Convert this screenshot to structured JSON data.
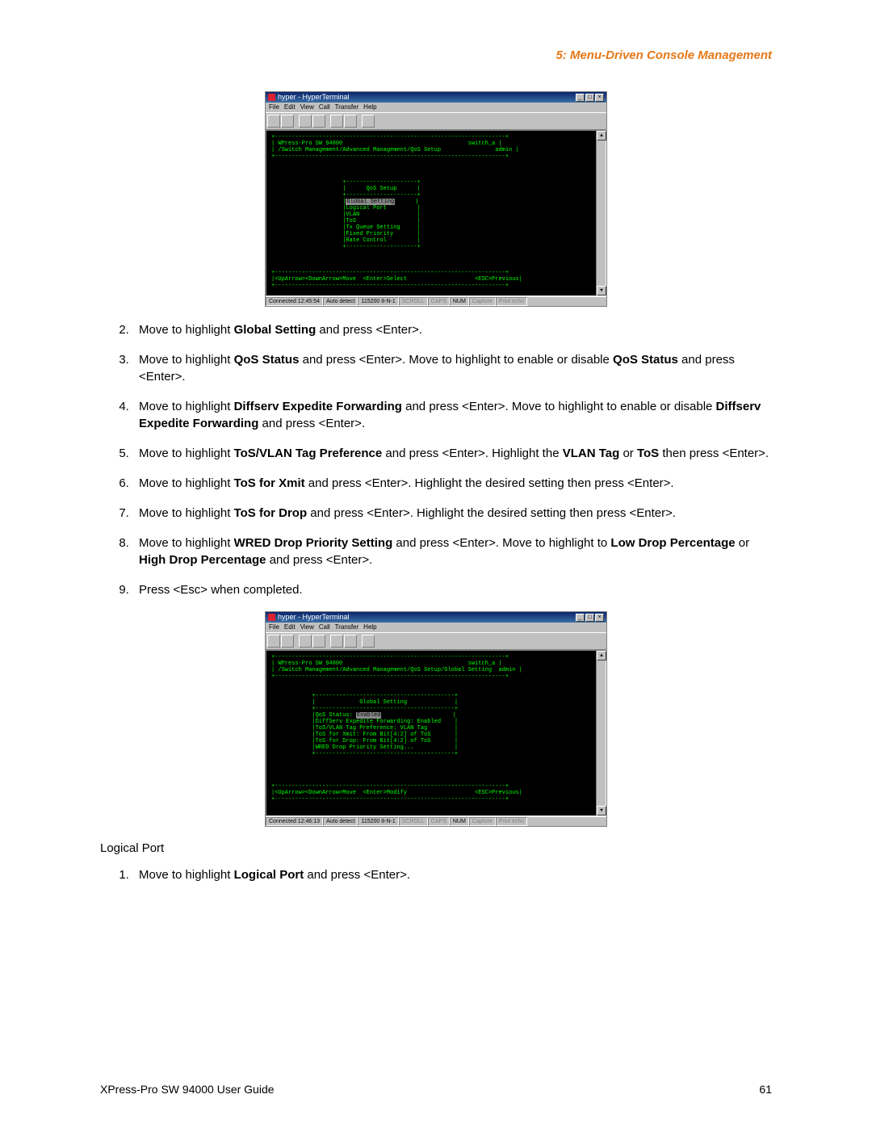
{
  "header": {
    "section_title": "5: Menu-Driven Console Management"
  },
  "screenshot1": {
    "window_title": "hyper - HyperTerminal",
    "menubar": [
      "File",
      "Edit",
      "View",
      "Call",
      "Transfer",
      "Help"
    ],
    "device_name": "WPress-Pro SW 94000",
    "breadcrumb": "/Switch Management/Advanced Management/QoS Setup",
    "session_name": "switch_a",
    "user": "admin",
    "panel_title": "QoS Setup",
    "menu_items": {
      "selected": "Global Setting",
      "items_rest": [
        "Logical Port",
        "VLAN",
        "ToS",
        "Tx Queue Setting",
        "Fixed Priority",
        "Rate Control"
      ]
    },
    "footer_hint_left": "<UpArrow><DownArrow>Move  <Enter>Select",
    "footer_hint_right": "<ESC>Previous",
    "status": {
      "conn": "Connected 12:45:54",
      "detect": "Auto detect",
      "baud": "115200 8-N-1",
      "flags": [
        "SCROLL",
        "CAPS",
        "NUM",
        "Capture",
        "Print echo"
      ]
    }
  },
  "steps_a": {
    "start": 2,
    "s2_pre": "Move to highlight ",
    "s2_bold": "Global Setting",
    "s2_post": " and press <Enter>.",
    "s3_a": "Move to highlight ",
    "s3_b1": "QoS Status",
    "s3_c": " and press <Enter>. Move to highlight to enable or disable ",
    "s3_b2": "QoS Status",
    "s3_d": " and press <Enter>.",
    "s4_a": "Move to highlight ",
    "s4_b1": "Diffserv Expedite Forwarding",
    "s4_c": " and press <Enter>. Move to highlight to enable or disable ",
    "s4_b2": "Diffserv Expedite Forwarding",
    "s4_d": " and press <Enter>.",
    "s5_a": "Move to highlight ",
    "s5_b1": "ToS/VLAN Tag Preference",
    "s5_c": " and press <Enter>. Highlight the ",
    "s5_b2": "VLAN Tag",
    "s5_mid": " or ",
    "s5_b3": "ToS",
    "s5_d": " then press <Enter>.",
    "s6_a": "Move to highlight ",
    "s6_b": "ToS for Xmit",
    "s6_c": " and press <Enter>. Highlight the desired setting then press <Enter>.",
    "s7_a": "Move to highlight ",
    "s7_b": "ToS for Drop",
    "s7_c": " and press <Enter>. Highlight the desired setting then press <Enter>.",
    "s8_a": "Move to highlight ",
    "s8_b1": "WRED Drop Priority Setting",
    "s8_c": " and press <Enter>. Move to highlight to ",
    "s8_b2": "Low Drop Percentage",
    "s8_mid": " or ",
    "s8_b3": "High Drop Percentage",
    "s8_d": " and press <Enter>.",
    "s9": "Press <Esc> when completed."
  },
  "screenshot2": {
    "window_title": "hyper - HyperTerminal",
    "menubar": [
      "File",
      "Edit",
      "View",
      "Call",
      "Transfer",
      "Help"
    ],
    "device_name": "WPress-Pro SW 94000",
    "breadcrumb": "/Switch Management/Advanced Management/QoS Setup/Global Setting",
    "session_name": "switch_a",
    "user": "admin",
    "panel_title": "Global Setting",
    "rows": {
      "qos_label": "QoS Status:",
      "qos_value": "Enabled",
      "diff_label": "DiffServ Expedite Forwarding:",
      "diff_value": "Enabled",
      "pref_label": "ToS/VLAN Tag Preference:",
      "pref_value": "VLAN Tag",
      "xmit_label": "ToS for Xmit:",
      "xmit_value": "From Bit[4:2] of ToS",
      "drop_label": "ToS for Drop:",
      "drop_value": "From Bit[4:2] of ToS",
      "wred": "WRED Drop Priority Setting..."
    },
    "footer_hint_left": "<UpArrow><DownArrow>Move  <Enter>Modify",
    "footer_hint_right": "<ESC>Previous",
    "status": {
      "conn": "Connected 12:46:13",
      "detect": "Auto detect",
      "baud": "115200 8-N-1",
      "flags": [
        "SCROLL",
        "CAPS",
        "NUM",
        "Capture",
        "Print echo"
      ]
    }
  },
  "section_b": {
    "label": "Logical Port",
    "s1_a": "Move to highlight ",
    "s1_b": "Logical Port",
    "s1_c": " and press <Enter>."
  },
  "footer": {
    "left": "XPress-Pro SW 94000 User Guide",
    "right": "61"
  }
}
